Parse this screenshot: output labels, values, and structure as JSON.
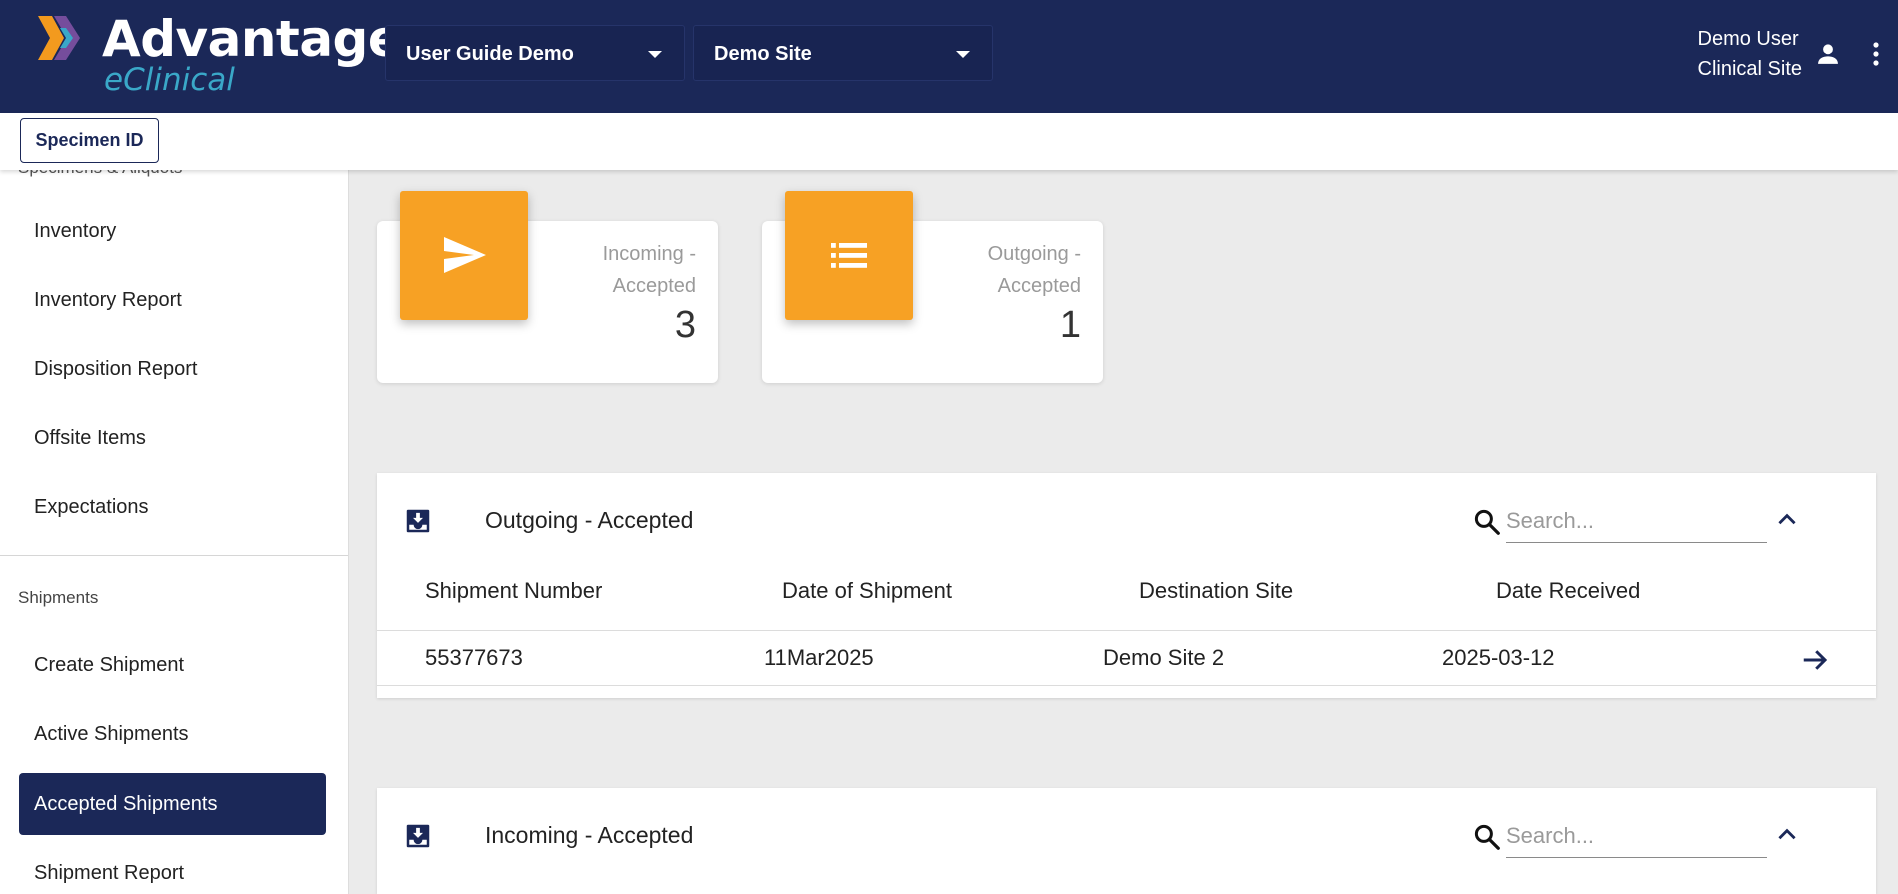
{
  "header": {
    "brand": "Advantage",
    "brand_sub": "eClinical",
    "study_select": "User Guide Demo",
    "site_select": "Demo Site",
    "user_name": "Demo User",
    "user_role": "Clinical Site",
    "icons": [
      "logo-chevrons-icon",
      "caret-down-icon",
      "person-icon",
      "more-vert-icon"
    ]
  },
  "subbar": {
    "specimen_button": "Specimen ID"
  },
  "sidebar": {
    "clipped_heading": "Specimens & Aliquots",
    "specimen_items": [
      "Inventory",
      "Inventory Report",
      "Disposition Report",
      "Offsite Items",
      "Expectations"
    ],
    "shipments_heading": "Shipments",
    "shipment_items": [
      "Create Shipment",
      "Active Shipments",
      "Accepted Shipments",
      "Shipment Report"
    ],
    "active_item": "Accepted Shipments"
  },
  "stats": [
    {
      "label_line1": "Incoming -",
      "label_line2": "Accepted",
      "value": "3",
      "icon": "send-icon"
    },
    {
      "label_line1": "Outgoing -",
      "label_line2": "Accepted",
      "value": "1",
      "icon": "list-icon"
    }
  ],
  "outgoing_panel": {
    "title": "Outgoing - Accepted",
    "search_placeholder": "Search...",
    "columns": [
      "Shipment Number",
      "Date of Shipment",
      "Destination Site",
      "Date Received"
    ],
    "rows": [
      {
        "shipment_number": "55377673",
        "date_of_shipment": "11Mar2025",
        "destination_site": "Demo Site 2",
        "date_received": "2025-03-12"
      }
    ]
  },
  "incoming_panel": {
    "title": "Incoming - Accepted",
    "search_placeholder": "Search..."
  },
  "colors": {
    "navy": "#1b2858",
    "accent_orange": "#f7a124",
    "logo_teal": "#3aa8c8",
    "background": "#ebebeb"
  }
}
